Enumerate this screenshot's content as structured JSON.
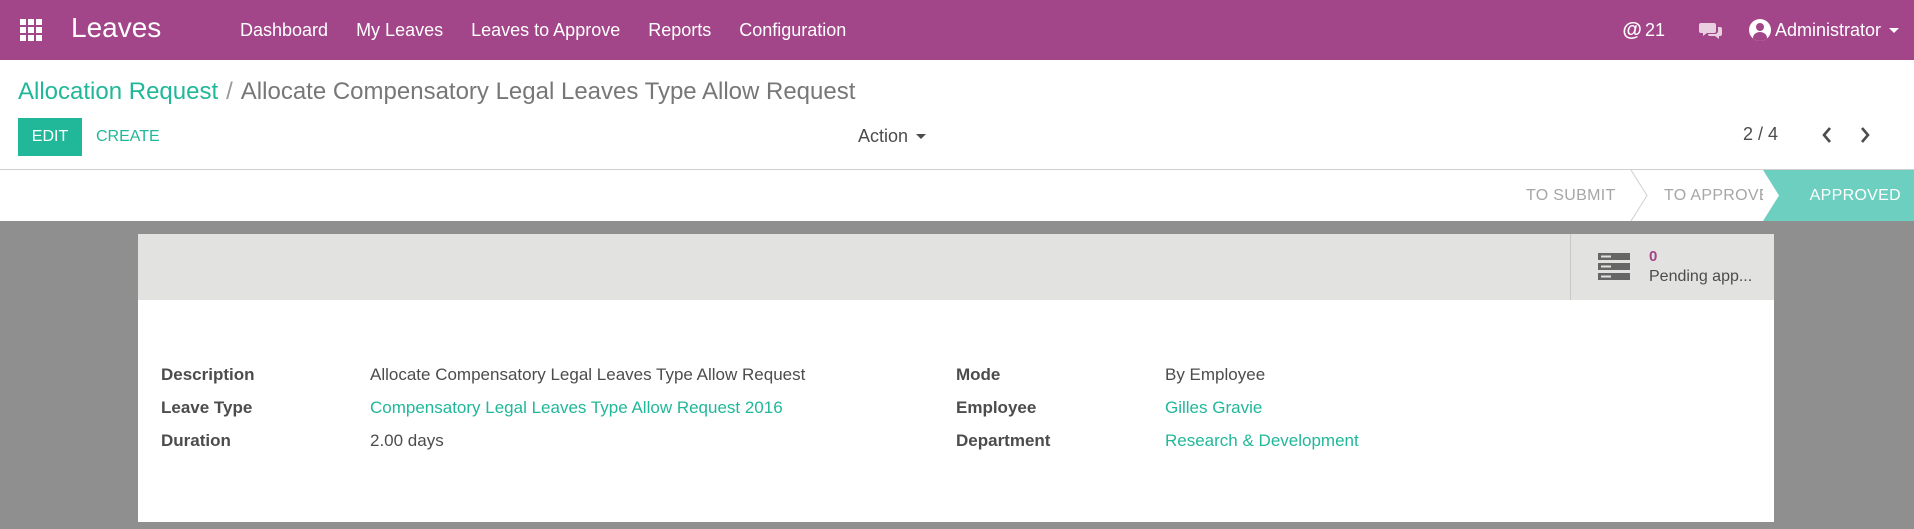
{
  "navbar": {
    "app_name": "Leaves",
    "menu": [
      "Dashboard",
      "My Leaves",
      "Leaves to Approve",
      "Reports",
      "Configuration"
    ],
    "mention_count": "21",
    "user_name": "Administrator"
  },
  "breadcrumb": {
    "parent": "Allocation Request",
    "separator": "/",
    "current": "Allocate Compensatory Legal Leaves Type Allow Request"
  },
  "controls": {
    "edit_label": "EDIT",
    "create_label": "CREATE",
    "action_label": "Action",
    "pager_value": "2 / 4"
  },
  "status": {
    "stages": [
      "TO SUBMIT",
      "TO APPROVE",
      "APPROVED"
    ],
    "active": "APPROVED"
  },
  "smart_button": {
    "value": "0",
    "label": "Pending app..."
  },
  "form": {
    "left": [
      {
        "label": "Description",
        "value": "Allocate Compensatory Legal Leaves Type Allow Request",
        "link": false
      },
      {
        "label": "Leave Type",
        "value": "Compensatory Legal Leaves Type Allow Request 2016",
        "link": true
      },
      {
        "label": "Duration",
        "value": "2.00 days",
        "link": false
      }
    ],
    "right": [
      {
        "label": "Mode",
        "value": "By Employee",
        "link": false
      },
      {
        "label": "Employee",
        "value": "Gilles Gravie",
        "link": true
      },
      {
        "label": "Department",
        "value": "Research & Development",
        "link": true
      }
    ]
  },
  "colors": {
    "navbar": "#a24689",
    "primary": "#21b799",
    "active_stage": "#6ccfc0"
  },
  "icons": [
    "apps-grid-icon",
    "at-icon",
    "chat-icon",
    "user-avatar-icon",
    "chevron-left-icon",
    "chevron-right-icon",
    "server-icon"
  ]
}
